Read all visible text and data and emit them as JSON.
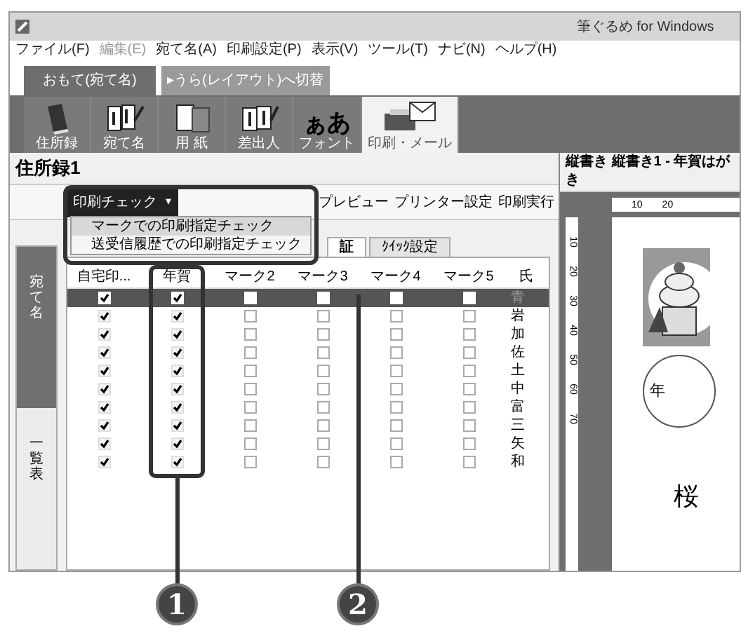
{
  "window": {
    "title": "筆ぐるめ for Windows"
  },
  "menu": [
    {
      "label": "ファイル(F)",
      "disabled": false
    },
    {
      "label": "編集(E)",
      "disabled": true
    },
    {
      "label": "宛て名(A)",
      "disabled": false
    },
    {
      "label": "印刷設定(P)",
      "disabled": false
    },
    {
      "label": "表示(V)",
      "disabled": false
    },
    {
      "label": "ツール(T)",
      "disabled": false
    },
    {
      "label": "ナビ(N)",
      "disabled": false
    },
    {
      "label": "ヘルプ(H)",
      "disabled": false
    }
  ],
  "mode_tabs": [
    {
      "label": "おもて(宛て名)",
      "selected": true
    },
    {
      "label": "▸うら(レイアウト)へ切替",
      "selected": false
    }
  ],
  "toolbar": [
    {
      "kind": "book",
      "label": "住所録",
      "selected": false
    },
    {
      "kind": "letter",
      "label": "宛て名",
      "selected": false
    },
    {
      "kind": "paper",
      "label": "用 紙",
      "selected": false
    },
    {
      "kind": "sender",
      "label": "差出人",
      "selected": false
    },
    {
      "kind": "font",
      "glyph": "ぁあ",
      "label": "フォント",
      "selected": false
    },
    {
      "kind": "print",
      "label": "印刷・メール",
      "selected": true
    }
  ],
  "address_book": {
    "title": "住所録1",
    "print_check": {
      "label": "印刷チェック",
      "caret": "▾"
    },
    "actions": [
      "プレビュー",
      "プリンター設定",
      "印刷実行"
    ],
    "dropdown": [
      {
        "label": "マークでの印刷指定チェック",
        "selected": true
      },
      {
        "label": "送受信履歴での印刷指定チェック",
        "selected": false
      }
    ],
    "tabs": [
      {
        "label": "証",
        "selected": true
      },
      {
        "label": "ｸｲｯｸ設定",
        "selected": false
      }
    ],
    "side_tabs": [
      {
        "label": "宛て名",
        "selected": true
      },
      {
        "label": "一覧表",
        "selected": false
      }
    ],
    "columns": [
      "自宅印...",
      "年賀",
      "マーク2",
      "マーク3",
      "マーク4",
      "マーク5",
      "氏"
    ],
    "rows": [
      {
        "selected": true,
        "checks": [
          true,
          true,
          false,
          false,
          false,
          false
        ],
        "name": "青"
      },
      {
        "selected": false,
        "checks": [
          true,
          true,
          false,
          false,
          false,
          false
        ],
        "name": "岩"
      },
      {
        "selected": false,
        "checks": [
          true,
          true,
          false,
          false,
          false,
          false
        ],
        "name": "加"
      },
      {
        "selected": false,
        "checks": [
          true,
          true,
          false,
          false,
          false,
          false
        ],
        "name": "佐"
      },
      {
        "selected": false,
        "checks": [
          true,
          true,
          false,
          false,
          false,
          false
        ],
        "name": "土"
      },
      {
        "selected": false,
        "checks": [
          true,
          true,
          false,
          false,
          false,
          false
        ],
        "name": "中"
      },
      {
        "selected": false,
        "checks": [
          true,
          true,
          false,
          false,
          false,
          false
        ],
        "name": "富"
      },
      {
        "selected": false,
        "checks": [
          true,
          true,
          false,
          false,
          false,
          false
        ],
        "name": "三"
      },
      {
        "selected": false,
        "checks": [
          true,
          true,
          false,
          false,
          false,
          false
        ],
        "name": "矢"
      },
      {
        "selected": false,
        "checks": [
          true,
          true,
          false,
          false,
          false,
          false
        ],
        "name": "和"
      }
    ]
  },
  "preview": {
    "title": "縦書き 縦書き1 - 年賀はがき",
    "ruler_h": [
      "10",
      "20"
    ],
    "ruler_v": [
      "10",
      "20",
      "30",
      "40",
      "50",
      "60",
      "70"
    ],
    "postmark": "年",
    "sender_name": "桜"
  },
  "callouts": [
    "1",
    "2"
  ]
}
